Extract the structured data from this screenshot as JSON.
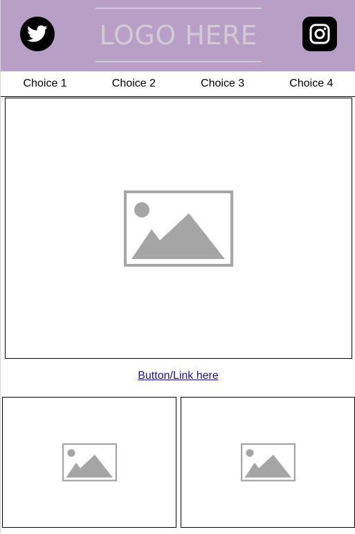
{
  "header": {
    "logo_text": "LOGO HERE",
    "background_color": "#b79fc6",
    "social": [
      {
        "icon": "twitter-icon"
      },
      {
        "icon": "instagram-icon"
      }
    ]
  },
  "nav": {
    "items": [
      "Choice 1",
      "Choice 2",
      "Choice 3",
      "Choice 4"
    ]
  },
  "hero": {
    "icon": "image-placeholder-icon"
  },
  "cta": {
    "label": "Button/Link here",
    "color": "#1a0dab"
  },
  "cards": [
    {
      "icon": "image-placeholder-icon"
    },
    {
      "icon": "image-placeholder-icon"
    }
  ]
}
